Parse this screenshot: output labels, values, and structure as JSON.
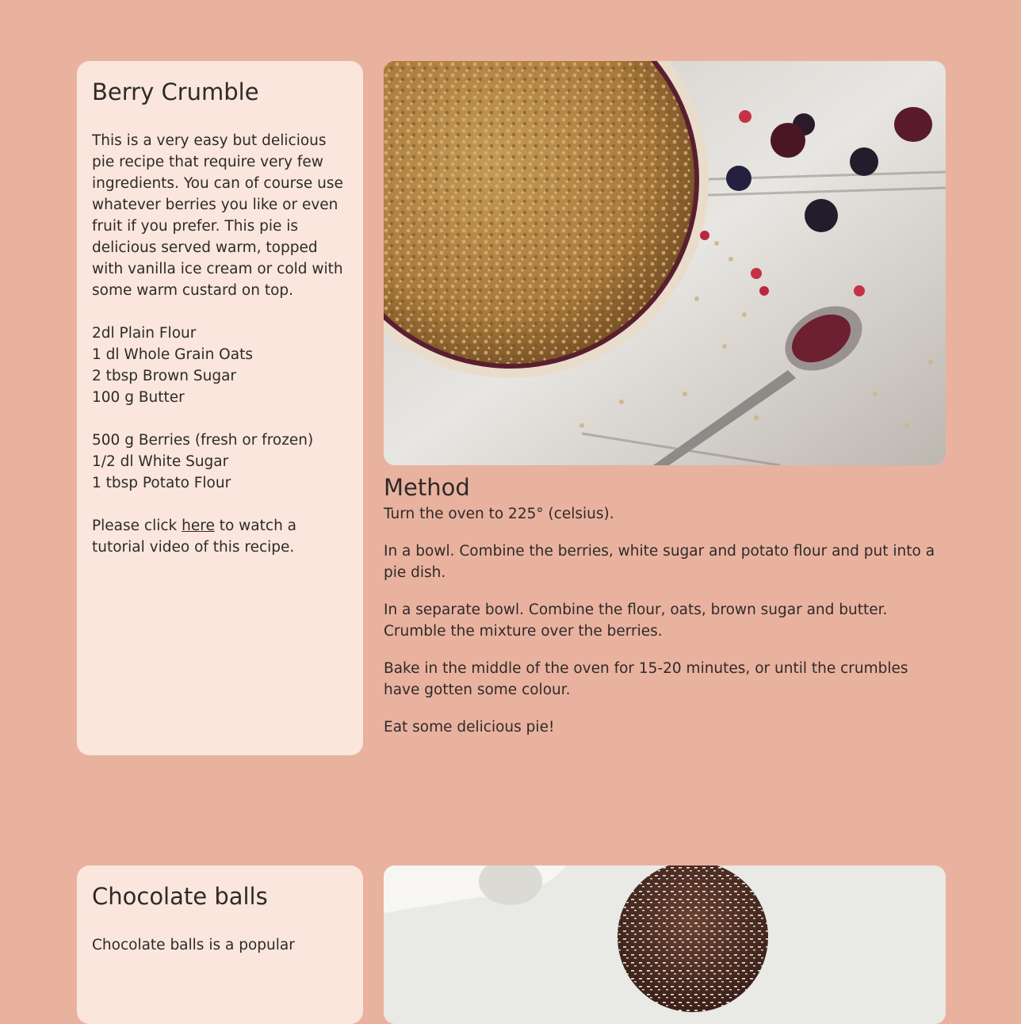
{
  "recipes": [
    {
      "title": "Berry Crumble",
      "intro": "This is a very easy but delicious pie recipe that require very few ingredients. You can of course use whatever berries you like or even fruit if you prefer. This pie is delicious served warm, topped with vanilla ice cream or cold with some warm custard on top.",
      "ingredient_groups": [
        [
          "2dl Plain Flour",
          "1 dl Whole Grain Oats",
          "2 tbsp Brown Sugar",
          "100 g Butter"
        ],
        [
          "500 g Berries (fresh or frozen)",
          "1/2 dl White Sugar",
          "1 tbsp Potato Flour"
        ]
      ],
      "tutorial": {
        "before": "Please click ",
        "link": "here",
        "after": " to watch a tutorial video of this recipe."
      },
      "method_heading": "Method",
      "method_steps": [
        "Turn the oven to 225° (celsius).",
        "In a bowl. Combine the berries, white sugar and potato flour and put into a pie dish.",
        "In a separate bowl. Combine the flour, oats, brown sugar and butter. Crumble the mixture over the berries.",
        "Bake in the middle of the oven for 15-20 minutes, or until the crumbles have gotten some colour.",
        "Eat some delicious pie!"
      ]
    },
    {
      "title": "Chocolate balls",
      "intro": "Chocolate balls is a popular"
    }
  ],
  "colors": {
    "page_background": "#e9b29f",
    "card_background": "#fae6dc",
    "text": "#2e2a29"
  }
}
